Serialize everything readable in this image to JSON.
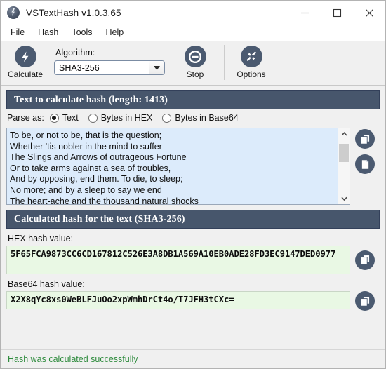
{
  "window": {
    "title": "VSTextHash v1.0.3.65",
    "app_icon": "lightning-bolt-app-icon",
    "minimize": "–",
    "maximize": "□",
    "close": "✕"
  },
  "menubar": {
    "items": [
      {
        "label": "File"
      },
      {
        "label": "Hash"
      },
      {
        "label": "Tools"
      },
      {
        "label": "Help"
      }
    ]
  },
  "toolbar": {
    "calculate_label": "Calculate",
    "calculate_icon": "lightning-bolt-icon",
    "algorithm_label": "Algorithm:",
    "algorithm_value": "SHA3-256",
    "algorithm_arrow_icon": "chevron-down-icon",
    "stop_label": "Stop",
    "stop_icon": "minus-circle-icon",
    "options_label": "Options",
    "options_icon": "wrench-screwdriver-icon"
  },
  "input_section": {
    "header": "Text to calculate hash (length: 1413)",
    "parse_label": "Parse as:",
    "parse_options": [
      {
        "label": "Text",
        "selected": true
      },
      {
        "label": "Bytes in HEX",
        "selected": false
      },
      {
        "label": "Bytes in Base64",
        "selected": false
      }
    ],
    "text_lines": [
      "To be, or not to be, that is the question;",
      "Whether 'tis nobler in the mind to suffer",
      "The Slings and Arrows of outrageous Fortune",
      "Or to take arms against a sea of troubles,",
      "And by opposing, end them. To die, to sleep;",
      "No more; and by a sleep to say we end",
      "The heart-ache and the thousand natural shocks"
    ],
    "copy_icon": "copy-pages-icon",
    "paste_icon": "single-page-icon",
    "scroll_up_icon": "chevron-up-icon",
    "scroll_down_icon": "chevron-down-icon"
  },
  "output_section": {
    "header": "Calculated hash for the text (SHA3-256)",
    "hex_label": "HEX hash value:",
    "hex_value": "5F65FCA9873CC6CD167812C526E3A8DB1A569A10EB0ADE28FD3EC9147DED0977",
    "base64_label": "Base64 hash value:",
    "base64_value": "X2X8qYc8xs0WeBLFJuOo2xpWmhDrCt4o/T7JFH3tCXc=",
    "copy_icon": "copy-pages-icon"
  },
  "statusbar": {
    "message": "Hash was calculated successfully",
    "message_color": "#2e8b3d"
  },
  "colors": {
    "header_bar": "#47566c",
    "input_background": "#dcebfb",
    "hash_background": "#e9f8e4",
    "icon_circle": "#4b5a70"
  }
}
